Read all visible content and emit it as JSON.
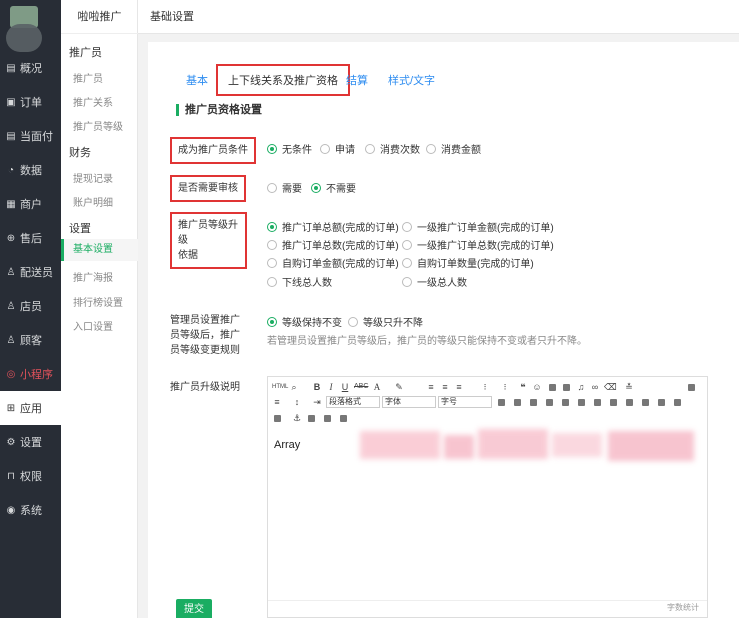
{
  "sidebar": {
    "items": [
      {
        "label": "概况",
        "icon": "overview-icon",
        "glyph": "▤"
      },
      {
        "label": "订单",
        "icon": "order-icon",
        "glyph": "▣"
      },
      {
        "label": "当面付",
        "icon": "pay-icon",
        "glyph": "▤"
      },
      {
        "label": "数据",
        "icon": "data-icon",
        "glyph": "◔"
      },
      {
        "label": "商户",
        "icon": "store-icon",
        "glyph": "▦"
      },
      {
        "label": "售后",
        "icon": "aftersale-icon",
        "glyph": "⊕"
      },
      {
        "label": "配送员",
        "icon": "courier-icon",
        "glyph": "♙"
      },
      {
        "label": "店员",
        "icon": "clerk-icon",
        "glyph": "♙"
      },
      {
        "label": "顾客",
        "icon": "customer-icon",
        "glyph": "♙"
      },
      {
        "label": "小程序",
        "icon": "miniprogram-icon",
        "glyph": "◎"
      },
      {
        "label": "应用",
        "icon": "apps-icon",
        "glyph": "⊞"
      },
      {
        "label": "设置",
        "icon": "settings-icon",
        "glyph": "⚙"
      },
      {
        "label": "权限",
        "icon": "permission-icon",
        "glyph": "⊓"
      },
      {
        "label": "系统",
        "icon": "system-icon",
        "glyph": "◉"
      }
    ]
  },
  "subnav": {
    "title": "啦啦推广",
    "groups": [
      {
        "label": "推广员",
        "items": [
          "推广员",
          "推广关系",
          "推广员等级"
        ]
      },
      {
        "label": "财务",
        "items": [
          "提现记录",
          "账户明细"
        ]
      },
      {
        "label": "设置",
        "items": [
          "基本设置",
          "推广海报",
          "排行榜设置",
          "入口设置"
        ]
      }
    ]
  },
  "header": {
    "title": "基础设置"
  },
  "tabs": [
    "基本",
    "上下线关系及推广资格",
    "结算",
    "样式/文字"
  ],
  "section_title": "推广员资格设置",
  "form": {
    "condition_label": "成为推广员条件",
    "condition_options": [
      "无条件",
      "申请",
      "消费次数",
      "消费金额"
    ],
    "review_label": "是否需要审核",
    "review_options": [
      "需要",
      "不需要"
    ],
    "upgrade_label_1": "推广员等级升级",
    "upgrade_label_2": "依据",
    "upgrade_options": [
      "推广订单总额(完成的订单)",
      "一级推广订单金额(完成的订单)",
      "推广订单总数(完成的订单)",
      "一级推广订单总数(完成的订单)",
      "自购订单金额(完成的订单)",
      "自购订单数量(完成的订单)",
      "下线总人数",
      "一级总人数"
    ],
    "admin_label_1": "管理员设置推广",
    "admin_label_2": "员等级后，推广",
    "admin_label_3": "员等级变更规则",
    "admin_options": [
      "等级保持不变",
      "等级只升不降"
    ],
    "admin_hint": "若管理员设置推广员等级后，推广员的等级只能保持不变或者只升不降。",
    "desc_label": "推广员升级说明"
  },
  "editor": {
    "content": "Array",
    "format_select": "段落格式",
    "font_select": "字体",
    "size_select": "字号",
    "word_count": "字数统计",
    "html_label": "HTML"
  },
  "submit_label": "提交"
}
